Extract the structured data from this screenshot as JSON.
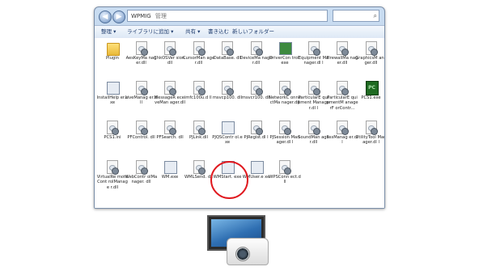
{
  "window": {
    "address": "WPMIG",
    "address_suffix": "管理",
    "nav_back": "◀",
    "nav_forward": "▶"
  },
  "toolbar": {
    "organize": "整理 ▾",
    "library": "ライブラリに追加 ▾",
    "share": "共有 ▾",
    "burn": "書き込む",
    "new_folder": "新しいフォルダー"
  },
  "files": [
    {
      "label": "Plugin",
      "type": "folder"
    },
    {
      "label": "AesKeyMa nager.dll",
      "type": "dll"
    },
    {
      "label": "ChkOSVer sion.dll",
      "type": "dll"
    },
    {
      "label": "CursorMan ager.dll",
      "type": "dll"
    },
    {
      "label": "DataBase. dll",
      "type": "dll"
    },
    {
      "label": "DeviceMa nager.dll",
      "type": "dll"
    },
    {
      "label": "DriverCon trol.exe",
      "type": "exe-green"
    },
    {
      "label": "Equipment Manager.dl l",
      "type": "dll"
    },
    {
      "label": "FirewallMa nager.dll",
      "type": "dll"
    },
    {
      "label": "GraphicsM anager.dll",
      "type": "dll"
    },
    {
      "label": "InstallHelp er.exe",
      "type": "exe"
    },
    {
      "label": "LiveManag er.dll",
      "type": "dll"
    },
    {
      "label": "MessageR eceiveMan ager.dll",
      "type": "dll"
    },
    {
      "label": "mfc100u.d ll",
      "type": "dll"
    },
    {
      "label": "msvcp100. dll",
      "type": "dll"
    },
    {
      "label": "msvcr100. dll",
      "type": "dll"
    },
    {
      "label": "NetworkC onnectMa nager.dll",
      "type": "dll"
    },
    {
      "label": "ParticularE quipment Manager.dl l",
      "type": "dll"
    },
    {
      "label": "ParticularE quipmentM anagerF orContr...",
      "type": "dll"
    },
    {
      "label": "PCS1.exe",
      "type": "green"
    },
    {
      "label": "PCS1.ini",
      "type": "dll"
    },
    {
      "label": "PFControl. dll",
      "type": "dll"
    },
    {
      "label": "PFSearch. dll",
      "type": "dll"
    },
    {
      "label": "PJLink.dll",
      "type": "dll"
    },
    {
      "label": "PJQSContr ol.exe",
      "type": "exe"
    },
    {
      "label": "PjRegist.dl l",
      "type": "dll"
    },
    {
      "label": "PJSession Manager.dl l",
      "type": "dll"
    },
    {
      "label": "SoundMan ager.dll",
      "type": "dll"
    },
    {
      "label": "SssManag er.dll",
      "type": "dll"
    },
    {
      "label": "UtilityTool Manager.dl l",
      "type": "dll"
    },
    {
      "label": "VirtualRe moteCont rolManage r.dll",
      "type": "dll"
    },
    {
      "label": "WebContr olManager. dll",
      "type": "dll"
    },
    {
      "label": "WM.exe",
      "type": "exe"
    },
    {
      "label": "WMLSend. dll",
      "type": "dll"
    },
    {
      "label": "WMStart. exe",
      "type": "exe"
    },
    {
      "label": "WMUser.e xe",
      "type": "exe"
    },
    {
      "label": "WPSConn ect.dll",
      "type": "dll"
    }
  ],
  "colors": {
    "highlight_circle": "#e0191f"
  }
}
